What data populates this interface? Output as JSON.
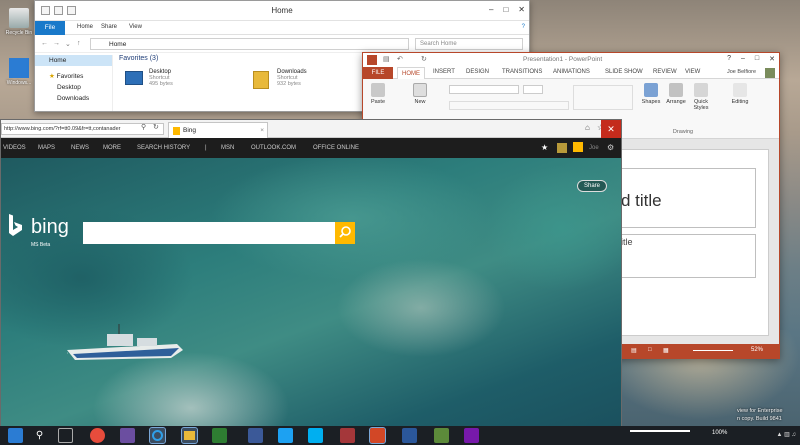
{
  "desktop": {
    "icons": [
      {
        "label": "Recycle Bin"
      },
      {
        "label": "Windows..."
      }
    ],
    "watermark_lines": [
      "view for Enterprise",
      "n copy. Build 9841"
    ]
  },
  "explorer": {
    "title": "Home",
    "tabs": [
      "File",
      "Home",
      "Share",
      "View"
    ],
    "address": "Home",
    "search_placeholder": "Search Home",
    "nav": [
      "Home",
      "Favorites",
      "Desktop",
      "Downloads"
    ],
    "favorites_header": "Favorites (3)",
    "files": [
      {
        "name": "Desktop",
        "type": "Shortcut",
        "size": "495 bytes"
      },
      {
        "name": "Downloads",
        "type": "Shortcut",
        "size": "932 bytes"
      }
    ]
  },
  "powerpoint": {
    "title": "Presentation1 - PowerPoint",
    "tabs": [
      "FILE",
      "HOME",
      "INSERT",
      "DESIGN",
      "TRANSITIONS",
      "ANIMATIONS",
      "SLIDE SHOW",
      "REVIEW",
      "VIEW"
    ],
    "user": "Joe Belfiore",
    "ribbon": {
      "paste": "Paste",
      "new": "New",
      "shapes": "Shapes",
      "arrange": "Arrange",
      "quick_styles": "Quick Styles",
      "editing": "Editing",
      "group_drawing": "Drawing"
    },
    "slide": {
      "title_fragment": "d title",
      "subtitle_fragment": "itle"
    },
    "status": {
      "zoom": "52%"
    }
  },
  "browser": {
    "url": "http://www.bing.com/?rf=tt0.09&fr=tt,contanader",
    "tab_title": "Bing",
    "nav": [
      "VIDEOS",
      "MAPS",
      "NEWS",
      "MORE",
      "SEARCH HISTORY",
      "|",
      "MSN",
      "OUTLOOK.COM",
      "OFFICE ONLINE"
    ],
    "bing_logo": "bing",
    "bing_sub": "MS Beta",
    "share": "Share",
    "user_initial": "Joe"
  },
  "taskbar": {
    "zoom_text": "100%"
  },
  "colors": {
    "ppt_accent": "#b7472a",
    "explorer_accent": "#1979ca",
    "bing_yellow": "#ffb900"
  }
}
